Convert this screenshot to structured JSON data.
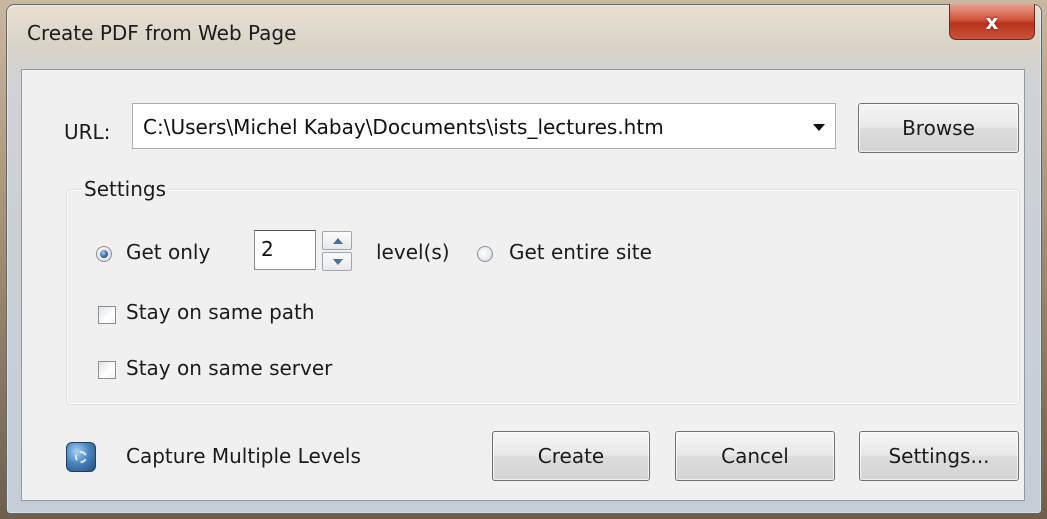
{
  "window": {
    "title": "Create PDF from Web Page",
    "close_glyph": "x"
  },
  "url": {
    "label": "URL:",
    "value": "C:\\Users\\Michel Kabay\\Documents\\ists_lectures.htm",
    "browse_label": "Browse"
  },
  "settings_group": {
    "label": "Settings",
    "get_only_label": "Get only",
    "get_only_selected": true,
    "levels_value": "2",
    "levels_label": "level(s)",
    "entire_site_label": "Get entire site",
    "entire_site_selected": false,
    "same_path_label": "Stay on same path",
    "same_path_checked": false,
    "same_server_label": "Stay on same server",
    "same_server_checked": false
  },
  "footer": {
    "capture_label": "Capture Multiple Levels",
    "capture_icon": "capture-levels-icon",
    "create_label": "Create",
    "cancel_label": "Cancel",
    "settings_label": "Settings..."
  },
  "colors": {
    "close_button": "#c9543a",
    "radio_selected": "#2c5f9e",
    "dialog_bg": "#f0f0f0"
  }
}
